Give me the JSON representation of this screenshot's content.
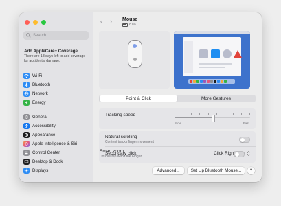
{
  "sidebar": {
    "search_placeholder": "Search",
    "applecare_title": "Add AppleCare+ Coverage",
    "applecare_text": "There are 18 days left to add coverage for accidental damage.",
    "items": [
      {
        "label": "Wi-Fi",
        "icon": "wifi-icon",
        "color": "#2d8cf5"
      },
      {
        "label": "Bluetooth",
        "icon": "bluetooth-icon",
        "color": "#2d8cf5"
      },
      {
        "label": "Network",
        "icon": "globe-icon",
        "color": "#2d8cf5"
      },
      {
        "label": "Energy",
        "icon": "energy-icon",
        "color": "#34b446"
      },
      {
        "label": "General",
        "icon": "gear-icon",
        "color": "#8e8e93"
      },
      {
        "label": "Accessibility",
        "icon": "accessibility-icon",
        "color": "#1477ef"
      },
      {
        "label": "Appearance",
        "icon": "appearance-icon",
        "color": "#1d1d1f"
      },
      {
        "label": "Apple Intelligence & Siri",
        "icon": "siri-icon",
        "color": "#e4577d"
      },
      {
        "label": "Control Center",
        "icon": "control-center-icon",
        "color": "#8e8e93"
      },
      {
        "label": "Desktop & Dock",
        "icon": "desktop-dock-icon",
        "color": "#1d1d1f"
      },
      {
        "label": "Displays",
        "icon": "displays-icon",
        "color": "#2d8cf5"
      }
    ]
  },
  "header": {
    "back": "‹",
    "forward": "›",
    "title": "Mouse",
    "battery": "81%"
  },
  "tabs": [
    {
      "label": "Point & Click",
      "active": true
    },
    {
      "label": "More Gestures",
      "active": false
    }
  ],
  "settings": {
    "tracking_label": "Tracking speed",
    "tracking_slow": "Slow",
    "tracking_fast": "Fast",
    "tracking_value": 0.5,
    "natural_label": "Natural scrolling",
    "natural_sub": "Content tracks finger movement",
    "secondary_label": "Secondary click",
    "secondary_value": "Click Right Side",
    "smart_label": "Smart zoom",
    "smart_sub": "Double-tap with One Finger"
  },
  "buttons": {
    "advanced": "Advanced...",
    "setup": "Set Up Bluetooth Mouse...",
    "help": "?"
  },
  "colors": {
    "accent": "#2d8cf5",
    "preview_bg": "#3d72cc"
  }
}
